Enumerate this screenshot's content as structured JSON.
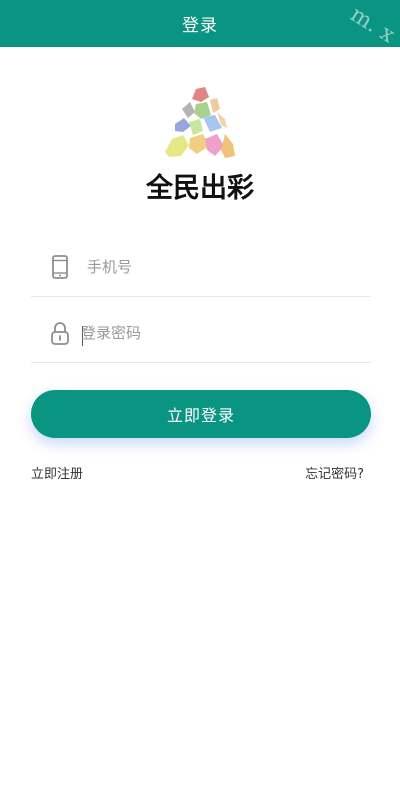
{
  "header": {
    "title": "登录",
    "watermark": "m. x"
  },
  "logo": {
    "text": "全民出彩",
    "icon": "triangle-mosaic-logo"
  },
  "form": {
    "phone": {
      "placeholder": "手机号",
      "value": "",
      "icon": "phone-icon"
    },
    "password": {
      "placeholder": "登录密码",
      "value": "",
      "icon": "lock-icon"
    },
    "submit_label": "立即登录"
  },
  "links": {
    "register": "立即注册",
    "forgot": "忘记密码?"
  },
  "colors": {
    "primary": "#0a9482",
    "text": "#333333",
    "placeholder": "#999999"
  }
}
